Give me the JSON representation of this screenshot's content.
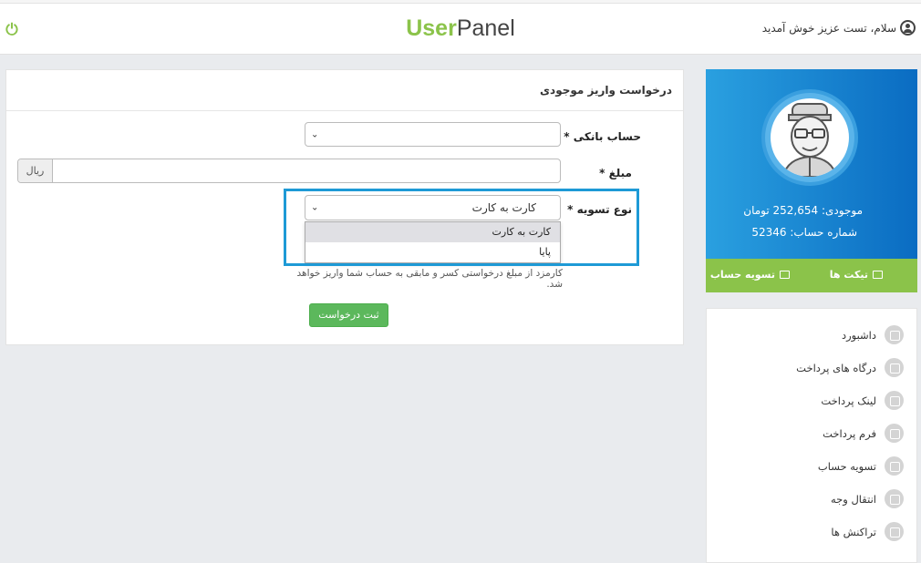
{
  "header": {
    "logo_user": "User",
    "logo_panel": "Panel",
    "greeting": "سلام، تست عزیز خوش آمدید"
  },
  "form": {
    "title": "درخواست واریز موجودی",
    "bank_account_label": "حساب بانکی *",
    "bank_account_value": "",
    "amount_label": "مبلغ *",
    "amount_currency": "ریال",
    "amount_value": "",
    "settlement_type_label": "نوع تسویه *",
    "settlement_type_value": "کارت به کارت",
    "settlement_options": [
      "کارت به کارت",
      "پایا"
    ],
    "help_text": "کارمزد از مبلغ درخواستی کسر و مابقی به حساب شما واریز خواهد شد.",
    "submit_label": "ثبت درخواست"
  },
  "profile": {
    "balance_text": "موجودی: 252,654 تومان",
    "account_text": "شماره حساب: 52346",
    "tickets_label": "تیکت ها",
    "settle_label": "تسویه حساب"
  },
  "nav": {
    "items": [
      {
        "label": "داشبورد",
        "icon": "dashboard-icon"
      },
      {
        "label": "درگاه های پرداخت",
        "icon": "share-icon"
      },
      {
        "label": "لینک پرداخت",
        "icon": "link-icon"
      },
      {
        "label": "فرم پرداخت",
        "icon": "check-square-icon"
      },
      {
        "label": "تسویه حساب",
        "icon": "card-icon"
      },
      {
        "label": "انتقال وجه",
        "icon": "credit-card-icon"
      },
      {
        "label": "تراکنش ها",
        "icon": "list-icon"
      }
    ]
  },
  "colors": {
    "brand_green": "#8bc34a",
    "profile_blue": "#1b85d2",
    "highlight": "#1e9ad6",
    "submit_green": "#5cb85c"
  }
}
